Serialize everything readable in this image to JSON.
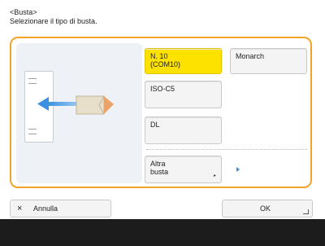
{
  "header": {
    "title": "<Busta>",
    "instruction": "Selezionare il tipo di busta."
  },
  "options": {
    "n10": "N. 10\n(COM10)",
    "monarch": "Monarch",
    "iso_c5": "ISO-C5",
    "dl": "DL",
    "altra": "Altra\nbusta"
  },
  "footer": {
    "cancel_icon": "×",
    "cancel": "Annulla",
    "ok": "OK"
  },
  "colors": {
    "selected": "#fde200",
    "panel_border": "#f2a42a",
    "arrow": "#3a8fe0"
  },
  "icons": {
    "illustration": "envelope-feed-illustration",
    "more": "chevron-right-icon",
    "enter": "enter-icon"
  }
}
